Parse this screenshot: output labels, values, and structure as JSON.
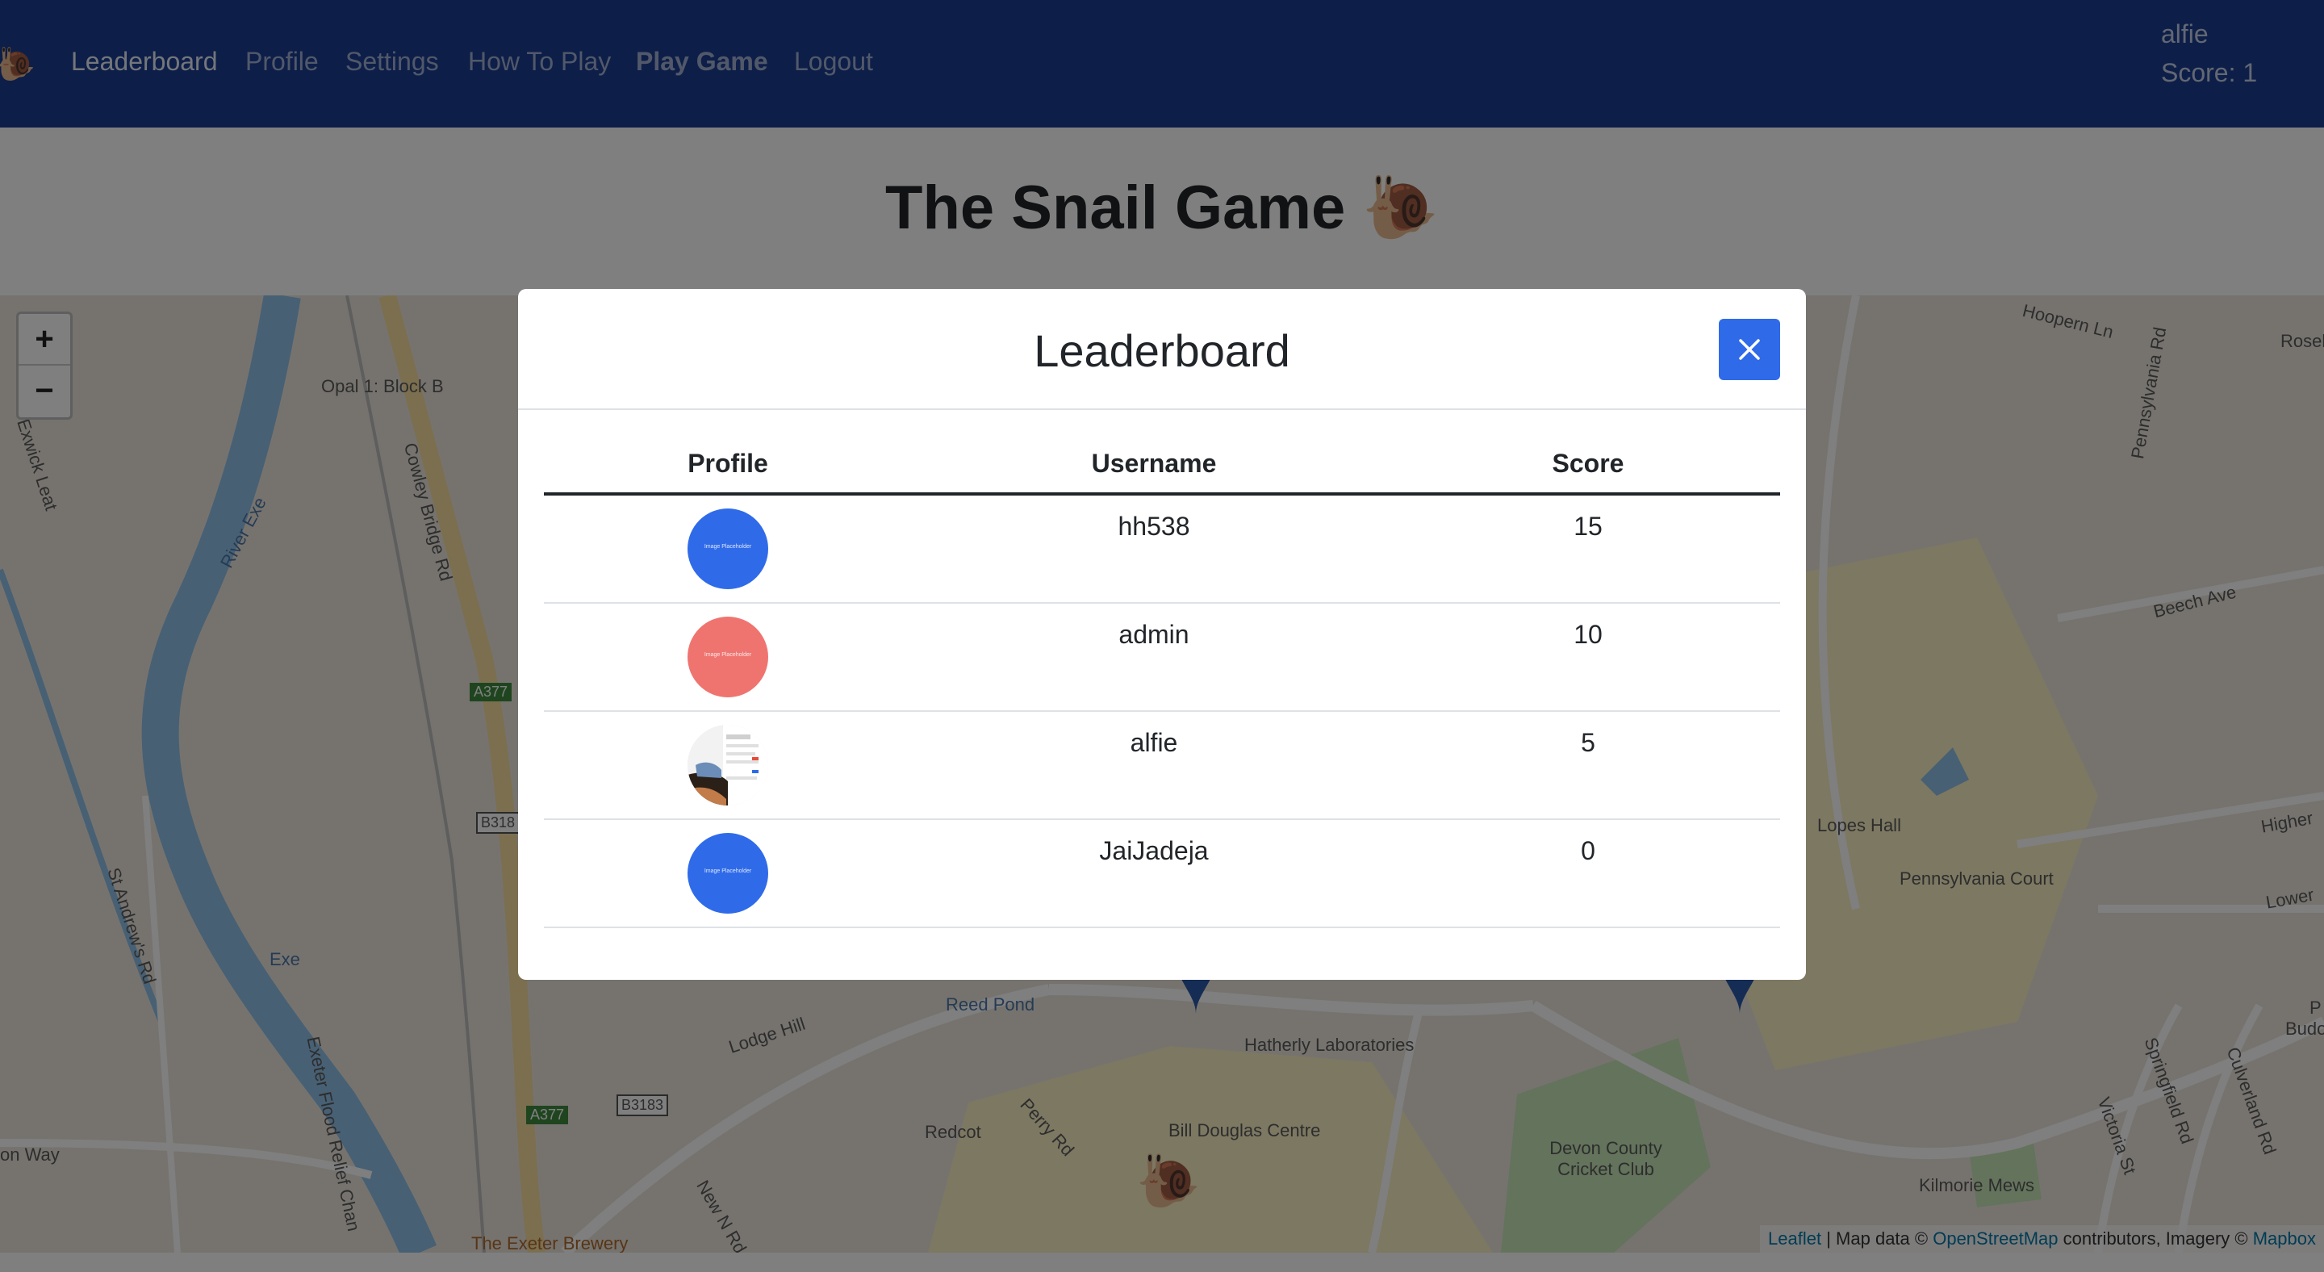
{
  "navbar": {
    "logo": "🐌",
    "links": [
      "Leaderboard",
      "Profile",
      "Settings",
      "How To Play",
      "Play Game",
      "Logout"
    ],
    "username": "alfie",
    "score": "Score: 1"
  },
  "page": {
    "title": "The Snail Game 🐌"
  },
  "map": {
    "zoom_in": "+",
    "zoom_out": "−",
    "labels": [
      "Opal 1: Block B",
      "Cowley Bridge Rd",
      "River Exe",
      "Exwick Leat",
      "A377",
      "B318",
      "St Andrew's Rd",
      "Exe",
      "Exeter Flood Relief Chan",
      "A377",
      "B3183",
      "New N Rd",
      "on Way",
      "The Exeter Brewery",
      "Lodge Hill",
      "Reed Pond",
      "Redcot",
      "Perry Rd",
      "Hatherly Laboratories",
      "Bill Douglas Centre",
      "Devon County Cricket Club",
      "Kilmorie Mews",
      "Lopes Hall",
      "Pennsylvania Court",
      "Beech Ave",
      "Hoopern Ln",
      "Pennsylvania Rd",
      "Rosel",
      "Higher",
      "Lower",
      "Springfield Rd",
      "Victoria St",
      "Culverland Rd",
      "P",
      "Budo"
    ],
    "snail": "🐌",
    "attribution": {
      "leaflet": "Leaflet",
      "sep1": " | Map data © ",
      "osm": "OpenStreetMap",
      "sep2": " contributors, Imagery © ",
      "mapbox": "Mapbox"
    }
  },
  "modal": {
    "title": "Leaderboard",
    "close_icon": "close-icon",
    "headers": [
      "Profile",
      "Username",
      "Score"
    ],
    "rows": [
      {
        "username": "hh538",
        "score": "15",
        "avatar_color": "#2f6be9",
        "avatar_text": "Image Placeholder"
      },
      {
        "username": "admin",
        "score": "10",
        "avatar_color": "#ef7470",
        "avatar_text": "Image Placeholder"
      },
      {
        "username": "alfie",
        "score": "5",
        "avatar_color": "photo",
        "avatar_text": ""
      },
      {
        "username": "JaiJadeja",
        "score": "0",
        "avatar_color": "#2f6be9",
        "avatar_text": "Image Placeholder"
      }
    ]
  },
  "colors": {
    "navbar": "#1a3d92",
    "primary": "#2f6be9",
    "water": "#8fc0e8",
    "road_yellow": "#f7dfa0",
    "park": "#c8e6b8",
    "campus": "#fbf0c4"
  }
}
